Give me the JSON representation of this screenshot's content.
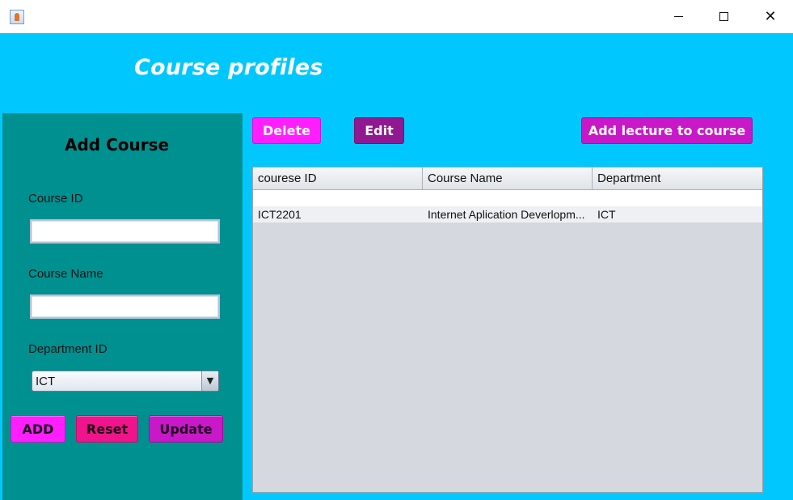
{
  "window": {
    "minimize_glyph": "",
    "maximize_glyph": "",
    "close_glyph": "✕",
    "icon": "java-cup-icon"
  },
  "header": {
    "title": "Course profiles"
  },
  "form": {
    "title": "Add Course",
    "course_id_label": "Course ID",
    "course_id_value": "",
    "course_name_label": "Course Name",
    "course_name_value": "",
    "department_label": "Department ID",
    "department_selected": "ICT",
    "department_arrow": "▼",
    "add_label": "ADD",
    "reset_label": "Reset",
    "update_label": "Update"
  },
  "toolbar": {
    "delete_label": "Delete",
    "edit_label": "Edit",
    "add_lecture_label": "Add lecture to course"
  },
  "table": {
    "columns": [
      "courese ID",
      "Course Name",
      "Department"
    ],
    "rows": [
      [
        "ICT2201",
        "Internet Aplication Deverlopm...",
        "ICT"
      ]
    ]
  },
  "colors": {
    "background": "#00c8ff",
    "panel": "#009090",
    "magenta": "#ff1eff",
    "pink": "#f0148c",
    "purple": "#c818c8",
    "dark_purple": "#901890"
  }
}
